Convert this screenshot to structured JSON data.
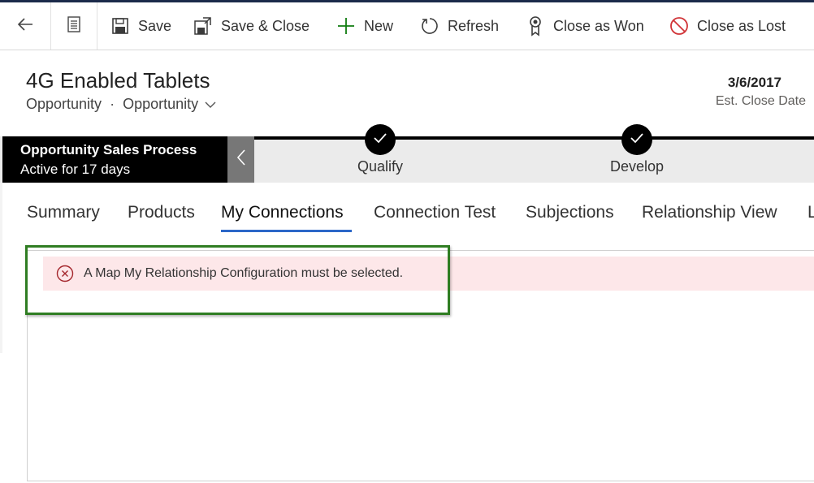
{
  "commands": {
    "save": "Save",
    "save_close": "Save & Close",
    "new": "New",
    "refresh": "Refresh",
    "close_won": "Close as Won",
    "close_lost": "Close as Lost"
  },
  "header": {
    "title": "4G Enabled Tablets",
    "entity": "Opportunity",
    "form_name": "Opportunity",
    "separator": "·",
    "est_close_date": "3/6/2017",
    "est_close_label": "Est. Close Date"
  },
  "process": {
    "name": "Opportunity Sales Process",
    "active_for": "Active for 17 days",
    "stages": [
      {
        "label": "Qualify",
        "completed": true
      },
      {
        "label": "Develop",
        "completed": true
      }
    ]
  },
  "tabs": [
    {
      "label": "Summary"
    },
    {
      "label": "Products"
    },
    {
      "label": "My Connections",
      "active": true
    },
    {
      "label": "Connection Test"
    },
    {
      "label": "Subjections"
    },
    {
      "label": "Relationship View"
    },
    {
      "label": "L"
    }
  ],
  "alert": {
    "message": "A Map My Relationship Configuration must be selected."
  },
  "colors": {
    "accent": "#2c67c8",
    "alert_bg": "#fde7e9",
    "alert_icon": "#a4262c",
    "highlight": "#2f7d22",
    "new_icon": "#107c10"
  },
  "icons": [
    "back-arrow-icon",
    "form-icon",
    "save-icon",
    "save-close-icon",
    "plus-icon",
    "refresh-icon",
    "award-icon",
    "prohibited-icon",
    "chevron-down-icon",
    "chevron-left-icon",
    "checkmark-icon",
    "error-circle-icon"
  ]
}
